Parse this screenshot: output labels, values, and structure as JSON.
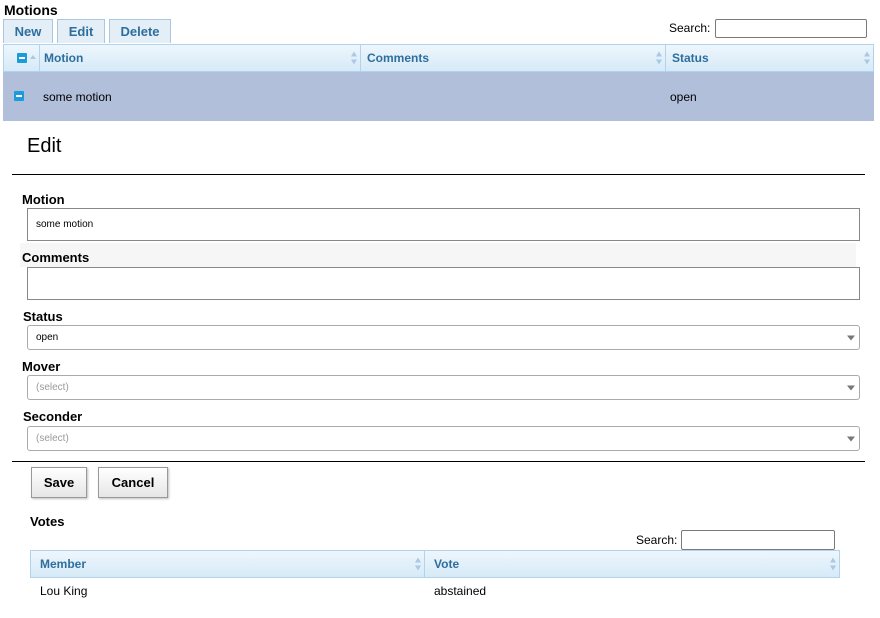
{
  "motions": {
    "title": "Motions",
    "toolbar": {
      "new_label": "New",
      "edit_label": "Edit",
      "delete_label": "Delete"
    },
    "search": {
      "label": "Search:",
      "value": ""
    },
    "columns": [
      "Motion",
      "Comments",
      "Status"
    ],
    "rows": [
      {
        "motion": "some motion",
        "comments": "",
        "status": "open"
      }
    ]
  },
  "edit": {
    "heading": "Edit",
    "motion": {
      "label": "Motion",
      "value": "some motion"
    },
    "comments": {
      "label": "Comments",
      "value": ""
    },
    "status": {
      "label": "Status",
      "value": "open"
    },
    "mover": {
      "label": "Mover",
      "value": "(select)"
    },
    "seconder": {
      "label": "Seconder",
      "value": "(select)"
    },
    "save_label": "Save",
    "cancel_label": "Cancel"
  },
  "votes": {
    "title": "Votes",
    "search": {
      "label": "Search:",
      "value": ""
    },
    "columns": [
      "Member",
      "Vote"
    ],
    "rows": [
      {
        "member": "Lou King",
        "vote": "abstained"
      }
    ]
  },
  "colors": {
    "selected_row": "#b1bfdb",
    "header_text": "#2e6e9e",
    "checkbox": "#1a9bdc"
  }
}
